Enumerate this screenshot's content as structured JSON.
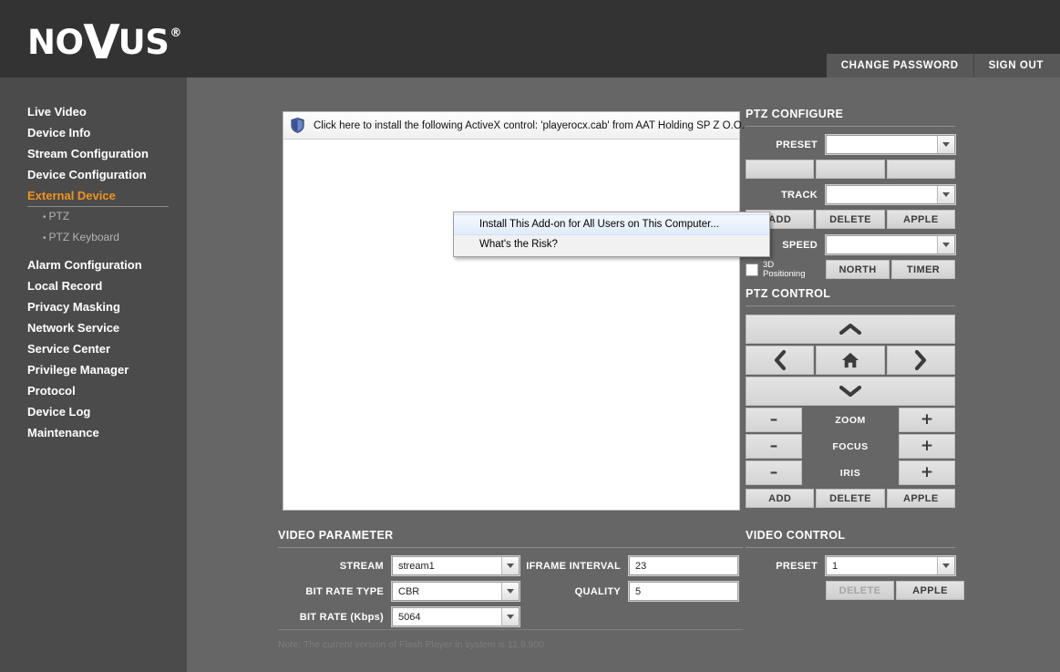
{
  "header": {
    "logo_pre": "NO",
    "logo_v": "V",
    "logo_post": "US",
    "logo_reg": "®",
    "change_password": "CHANGE PASSWORD",
    "sign_out": "SIGN OUT",
    "bg": "#333333",
    "accent": "#f0921e"
  },
  "sidebar": {
    "items": [
      {
        "label": "Live Video",
        "type": "main",
        "active": false
      },
      {
        "label": "Device Info",
        "type": "main",
        "active": false
      },
      {
        "label": "Stream Configuration",
        "type": "main",
        "active": false
      },
      {
        "label": "Device Configuration",
        "type": "main",
        "active": false
      },
      {
        "label": "External Device",
        "type": "main",
        "active": true
      },
      {
        "label": "PTZ",
        "type": "sub",
        "active": false
      },
      {
        "label": "PTZ Keyboard",
        "type": "sub",
        "active": false
      },
      {
        "label": "Alarm Configuration",
        "type": "main",
        "active": false
      },
      {
        "label": "Local Record",
        "type": "main",
        "active": false
      },
      {
        "label": "Privacy Masking",
        "type": "main",
        "active": false
      },
      {
        "label": "Network Service",
        "type": "main",
        "active": false
      },
      {
        "label": "Service Center",
        "type": "main",
        "active": false
      },
      {
        "label": "Privilege Manager",
        "type": "main",
        "active": false
      },
      {
        "label": "Protocol",
        "type": "main",
        "active": false
      },
      {
        "label": "Device Log",
        "type": "main",
        "active": false
      },
      {
        "label": "Maintenance",
        "type": "main",
        "active": false
      }
    ]
  },
  "activex_bar": {
    "icon": "shield-icon",
    "message": "Click here to install the following ActiveX control: 'playerocx.cab' from AAT Holding  SP Z O.O."
  },
  "context_menu": {
    "items": [
      {
        "label": "Install This Add-on for All Users on This Computer...",
        "hovered": true
      },
      {
        "label": "What's the Risk?",
        "hovered": false
      }
    ]
  },
  "ptz_configure": {
    "title": "PTZ CONFIGURE",
    "preset_label": "PRESET",
    "preset_value": "",
    "preset_buttons": [
      "",
      "",
      ""
    ],
    "track_label": "TRACK",
    "track_value": "",
    "track_buttons": [
      "ADD",
      "DELETE",
      "APPLE"
    ],
    "speed_label": "SPEED",
    "speed_value": "",
    "positioning_label_line1": "3D",
    "positioning_label_line2": "Positioning",
    "positioning_checked": false,
    "bottom_buttons": [
      "NORTH",
      "TIMER"
    ]
  },
  "ptz_control": {
    "title": "PTZ CONTROL",
    "up_icon": "chevron-up-icon",
    "left_icon": "chevron-left-icon",
    "home_icon": "home-icon",
    "right_icon": "chevron-right-icon",
    "down_icon": "chevron-down-icon",
    "minus": "–",
    "plus": "+",
    "lens_rows": [
      "ZOOM",
      "FOCUS",
      "IRIS"
    ],
    "action_buttons": [
      "ADD",
      "DELETE",
      "APPLE"
    ]
  },
  "video_parameter": {
    "title": "VIDEO PARAMETER",
    "stream_label": "STREAM",
    "stream_value": "stream1",
    "bitrate_type_label": "BIT RATE TYPE",
    "bitrate_type_value": "CBR",
    "bitrate_label": "BIT RATE (Kbps)",
    "bitrate_value": "5064",
    "iframe_label": "IFRAME INTERVAL",
    "iframe_value": "23",
    "quality_label": "QUALITY",
    "quality_value": "5"
  },
  "video_control": {
    "title": "VIDEO CONTROL",
    "preset_label": "PRESET",
    "preset_value": "1",
    "delete_label": "DELETE",
    "apple_label": "APPLE",
    "delete_disabled": true
  },
  "footer": {
    "note": "Note: The current version of Flash Player in system is 11.9.900"
  }
}
